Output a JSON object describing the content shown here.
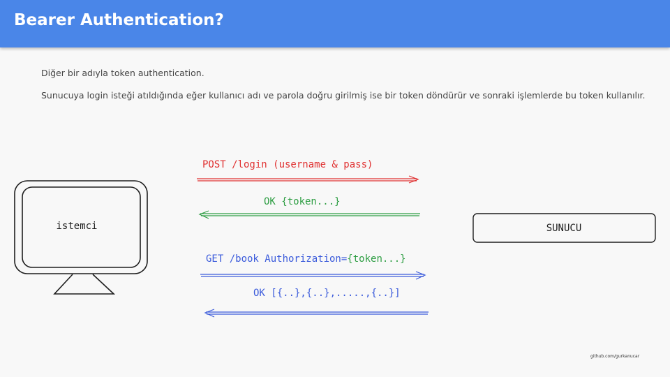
{
  "header": {
    "title": "Bearer Authentication?"
  },
  "content": {
    "line1": "Diğer bir adıyla token authentication.",
    "line2": "Sunucuya  login isteği atıldığında eğer kullanıcı  adı ve parola doğru girilmiş ise bir token döndürür  ve sonraki  işlemlerde bu token kullanılır."
  },
  "diagram": {
    "client_label": "istemci",
    "server_label": "SUNUCU",
    "msg1": "POST /login (username & pass)",
    "msg2": "OK {token...}",
    "msg3_a": "GET /book Authorization=",
    "msg3_b": "{token...}",
    "msg4": "OK [{..},{..},.....,{..}]",
    "colors": {
      "red": "#e03131",
      "green": "#2f9e44",
      "blue": "#3b5bdb",
      "ink": "#1e1e1e"
    }
  },
  "footer": {
    "credit": "github.com/gurkanucar"
  }
}
